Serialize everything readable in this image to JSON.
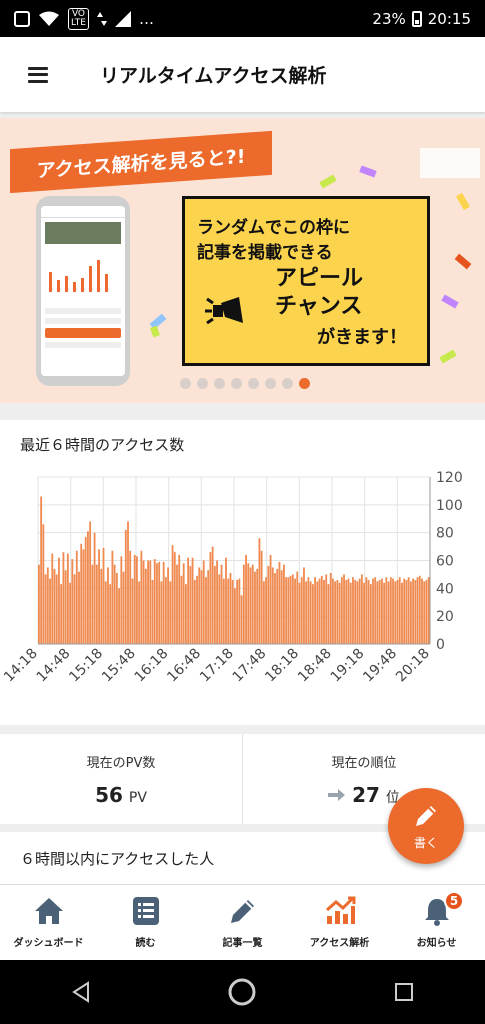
{
  "status_bar": {
    "battery": "23%",
    "time": "20:15",
    "volte": "VoLTE",
    "more": "…"
  },
  "app_bar": {
    "title": "リアルタイムアクセス解析"
  },
  "banner": {
    "ribbon_text": "アクセス解析を見ると?!",
    "line1": "ランダムでこの枠に",
    "line2": "記事を掲載できる",
    "line3a": "アピール",
    "line3b": "チャンス",
    "line4": "がきます！",
    "page_count": 8,
    "active_page": 7
  },
  "chart_section": {
    "title": "最近６時間のアクセス数"
  },
  "chart_data": {
    "type": "bar",
    "title": "最近６時間のアクセス数",
    "ylim": [
      0,
      120
    ],
    "y_ticks": [
      "0",
      "20",
      "40",
      "60",
      "80",
      "100",
      "120"
    ],
    "x_tick_labels": [
      "14:18",
      "14:48",
      "15:18",
      "15:48",
      "16:18",
      "16:48",
      "17:18",
      "17:48",
      "18:18",
      "18:48",
      "19:18",
      "19:48",
      "20:18"
    ],
    "grid": true,
    "bar_color": "#ef8a50",
    "values": [
      57,
      106,
      86,
      50,
      55,
      47,
      65,
      54,
      50,
      62,
      43,
      66,
      53,
      65,
      44,
      61,
      50,
      67,
      52,
      72,
      68,
      77,
      81,
      88,
      57,
      80,
      57,
      68,
      54,
      69,
      45,
      55,
      43,
      67,
      57,
      51,
      40,
      63,
      52,
      82,
      88,
      67,
      47,
      64,
      63,
      45,
      67,
      60,
      54,
      60,
      60,
      46,
      61,
      58,
      59,
      45,
      59,
      48,
      55,
      45,
      71,
      66,
      57,
      64,
      49,
      58,
      43,
      62,
      56,
      62,
      46,
      49,
      55,
      53,
      60,
      48,
      53,
      66,
      70,
      56,
      60,
      50,
      57,
      47,
      62,
      47,
      51,
      46,
      40,
      46,
      47,
      35,
      57,
      64,
      58,
      55,
      57,
      52,
      54,
      76,
      67,
      45,
      48,
      56,
      64,
      55,
      51,
      54,
      59,
      53,
      57,
      48,
      48,
      49,
      50,
      47,
      52,
      44,
      48,
      55,
      45,
      48,
      45,
      43,
      48,
      45,
      47,
      49,
      46,
      50,
      43,
      51,
      47,
      45,
      46,
      44,
      48,
      50,
      46,
      47,
      44,
      48,
      46,
      45,
      47,
      50,
      44,
      48,
      46,
      43,
      47,
      48,
      45,
      46,
      47,
      44,
      48,
      45,
      48,
      47,
      45,
      46,
      48,
      44,
      47,
      46,
      48,
      45,
      47,
      46,
      48,
      49,
      47,
      45,
      46,
      48
    ]
  },
  "stats": {
    "pv_label": "現在のPV数",
    "pv_value": "56",
    "pv_unit": "PV",
    "rank_label": "現在の順位",
    "rank_value": "27",
    "rank_unit": "位"
  },
  "visitors": {
    "title": "６時間以内にアクセスした人"
  },
  "fab": {
    "label": "書く"
  },
  "bottom_nav": {
    "items": [
      {
        "label": "ダッシュボード"
      },
      {
        "label": "読む"
      },
      {
        "label": "記事一覧"
      },
      {
        "label": "アクセス解析"
      },
      {
        "label": "お知らせ",
        "badge": "5"
      }
    ],
    "active_color": "#ec6a2c",
    "icon_color": "#4a6178"
  }
}
